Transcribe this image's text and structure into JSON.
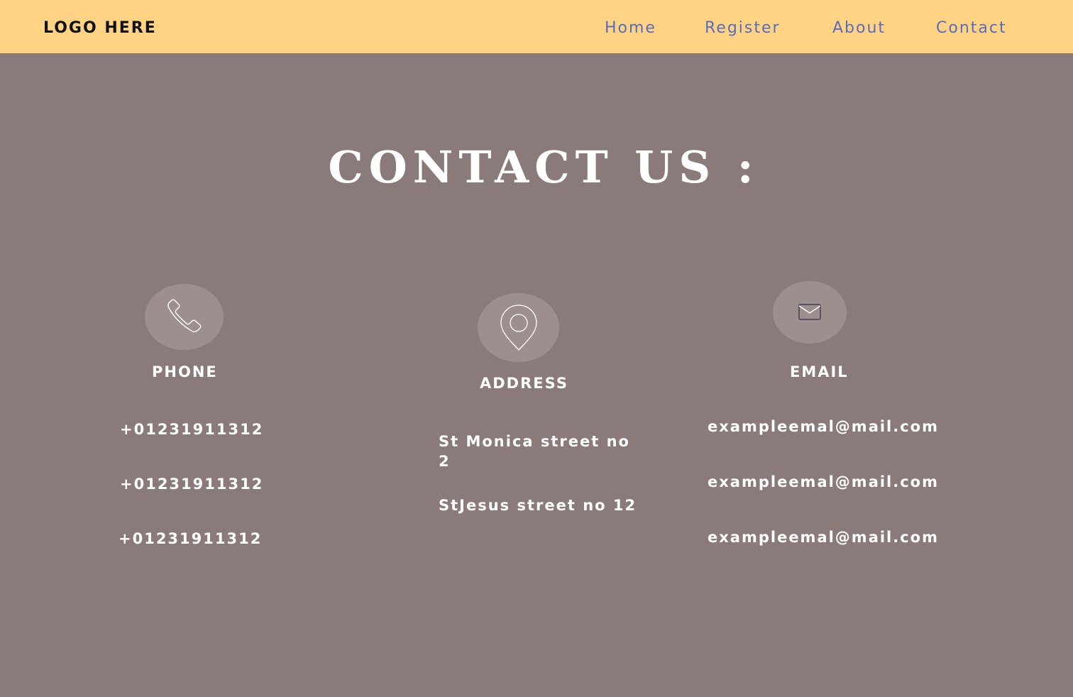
{
  "nav": {
    "logo": "LOGO HERE",
    "links": [
      "Home",
      "Register",
      "About",
      "Contact"
    ]
  },
  "title": "CONTACT US :",
  "phone": {
    "icon": "phone-icon",
    "heading": "PHONE",
    "items": [
      "+01231911312",
      "+01231911312",
      "+01231911312"
    ]
  },
  "address": {
    "icon": "location-pin-icon",
    "heading": "ADDRESS",
    "items": [
      "St Monica street no 2",
      "StJesus street no 12"
    ]
  },
  "email": {
    "icon": "envelope-icon",
    "heading": "EMAIL",
    "items": [
      "exampleemal@mail.com",
      "exampleemal@mail.com",
      "exampleemal@mail.com"
    ]
  },
  "colors": {
    "navbar": "#ffd384",
    "background": "#8a7b7a",
    "nav_link": "#5b6bbb",
    "icon_circle": "#9d8f8e"
  }
}
